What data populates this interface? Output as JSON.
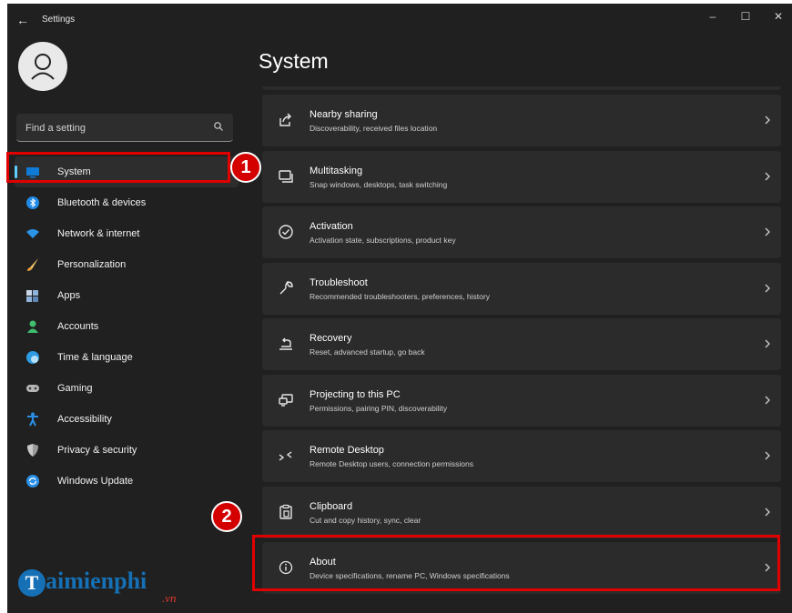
{
  "window": {
    "title": "Settings",
    "controls": {
      "minimize": "–",
      "maximize": "☐",
      "close": "✕"
    },
    "back_icon": "back-arrow-icon"
  },
  "sidebar": {
    "search_placeholder": "Find a setting",
    "items": [
      {
        "label": "System",
        "icon": "display-icon",
        "color": "#0f7bd6",
        "selected": true
      },
      {
        "label": "Bluetooth & devices",
        "icon": "bluetooth-icon",
        "color": "#1f8ae6"
      },
      {
        "label": "Network & internet",
        "icon": "wifi-icon",
        "color": "#2a94e8"
      },
      {
        "label": "Personalization",
        "icon": "brush-icon",
        "color": "#f2a03c"
      },
      {
        "label": "Apps",
        "icon": "apps-icon",
        "color": "#8fb3d9"
      },
      {
        "label": "Accounts",
        "icon": "person-icon",
        "color": "#3fbf6f"
      },
      {
        "label": "Time & language",
        "icon": "globe-clock-icon",
        "color": "#2e9be3"
      },
      {
        "label": "Gaming",
        "icon": "gamepad-icon",
        "color": "#b5b5b5"
      },
      {
        "label": "Accessibility",
        "icon": "accessibility-icon",
        "color": "#2a8fe6"
      },
      {
        "label": "Privacy & security",
        "icon": "shield-icon",
        "color": "#9a9a9a"
      },
      {
        "label": "Windows Update",
        "icon": "update-icon",
        "color": "#2a8fe6"
      }
    ]
  },
  "main": {
    "title": "System",
    "cards": [
      {
        "title": "Nearby sharing",
        "subtitle": "Discoverability, received files location",
        "icon": "share-icon"
      },
      {
        "title": "Multitasking",
        "subtitle": "Snap windows, desktops, task switching",
        "icon": "multitasking-icon"
      },
      {
        "title": "Activation",
        "subtitle": "Activation state, subscriptions, product key",
        "icon": "check-circle-icon"
      },
      {
        "title": "Troubleshoot",
        "subtitle": "Recommended troubleshooters, preferences, history",
        "icon": "wrench-icon"
      },
      {
        "title": "Recovery",
        "subtitle": "Reset, advanced startup, go back",
        "icon": "recovery-icon"
      },
      {
        "title": "Projecting to this PC",
        "subtitle": "Permissions, pairing PIN, discoverability",
        "icon": "projector-icon"
      },
      {
        "title": "Remote Desktop",
        "subtitle": "Remote Desktop users, connection permissions",
        "icon": "remote-desktop-icon"
      },
      {
        "title": "Clipboard",
        "subtitle": "Cut and copy history, sync, clear",
        "icon": "clipboard-icon"
      },
      {
        "title": "About",
        "subtitle": "Device specifications, rename PC, Windows specifications",
        "icon": "info-icon"
      }
    ]
  },
  "annotations": {
    "badge1": "1",
    "badge2": "2",
    "highlight_color": "#e00000"
  },
  "watermark": {
    "t": "T",
    "name": "aimienphi",
    "suffix": ".vn"
  }
}
